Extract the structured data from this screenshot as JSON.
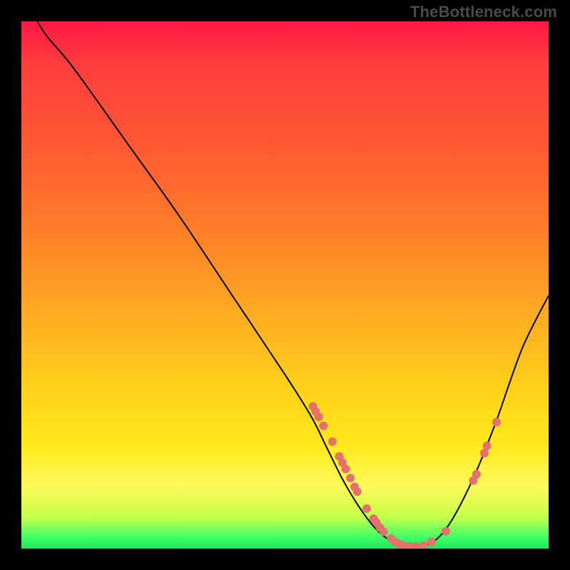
{
  "watermark": "TheBottleneck.com",
  "chart_data": {
    "type": "line",
    "title": "",
    "xlabel": "",
    "ylabel": "",
    "xlim": [
      0,
      100
    ],
    "ylim": [
      0,
      100
    ],
    "grid": false,
    "legend": false,
    "series": [
      {
        "name": "curve",
        "points": [
          {
            "x": 3,
            "y": 100
          },
          {
            "x": 5,
            "y": 97
          },
          {
            "x": 10,
            "y": 91
          },
          {
            "x": 20,
            "y": 77
          },
          {
            "x": 30,
            "y": 63
          },
          {
            "x": 40,
            "y": 48
          },
          {
            "x": 50,
            "y": 33
          },
          {
            "x": 55,
            "y": 25
          },
          {
            "x": 58,
            "y": 19
          },
          {
            "x": 61,
            "y": 13
          },
          {
            "x": 64,
            "y": 8
          },
          {
            "x": 67,
            "y": 4
          },
          {
            "x": 70,
            "y": 1.5
          },
          {
            "x": 73,
            "y": 0.5
          },
          {
            "x": 76,
            "y": 0.5
          },
          {
            "x": 79,
            "y": 2
          },
          {
            "x": 82,
            "y": 6
          },
          {
            "x": 86,
            "y": 14
          },
          {
            "x": 90,
            "y": 24
          },
          {
            "x": 95,
            "y": 38
          },
          {
            "x": 100,
            "y": 48
          }
        ]
      }
    ],
    "markers": [
      {
        "x": 55.3,
        "y": 27
      },
      {
        "x": 55.8,
        "y": 26
      },
      {
        "x": 56.4,
        "y": 25
      },
      {
        "x": 57.3,
        "y": 23.3
      },
      {
        "x": 59.0,
        "y": 20.3
      },
      {
        "x": 60.3,
        "y": 17.5
      },
      {
        "x": 60.9,
        "y": 16.3
      },
      {
        "x": 61.5,
        "y": 15.1
      },
      {
        "x": 62.4,
        "y": 13.4
      },
      {
        "x": 63.2,
        "y": 11.7
      },
      {
        "x": 63.7,
        "y": 10.8
      },
      {
        "x": 65.5,
        "y": 7.6
      },
      {
        "x": 66.8,
        "y": 5.7
      },
      {
        "x": 67.3,
        "y": 5.0
      },
      {
        "x": 68.0,
        "y": 4.0
      },
      {
        "x": 68.7,
        "y": 3.2
      },
      {
        "x": 70.1,
        "y": 1.9
      },
      {
        "x": 71.0,
        "y": 1.2
      },
      {
        "x": 71.6,
        "y": 0.9
      },
      {
        "x": 72.4,
        "y": 0.6
      },
      {
        "x": 73.6,
        "y": 0.4
      },
      {
        "x": 74.8,
        "y": 0.4
      },
      {
        "x": 76.3,
        "y": 0.6
      },
      {
        "x": 77.8,
        "y": 1.3
      },
      {
        "x": 80.5,
        "y": 3.3
      },
      {
        "x": 85.7,
        "y": 12.9
      },
      {
        "x": 86.3,
        "y": 14.1
      },
      {
        "x": 87.8,
        "y": 18.1
      },
      {
        "x": 88.3,
        "y": 19.5
      },
      {
        "x": 90.1,
        "y": 24.0
      }
    ],
    "background_gradient": {
      "direction": "vertical",
      "stops": [
        {
          "pos": 0.0,
          "color": "#ff1744"
        },
        {
          "pos": 0.22,
          "color": "#ff5534"
        },
        {
          "pos": 0.55,
          "color": "#ffaa22"
        },
        {
          "pos": 0.8,
          "color": "#ffe81a"
        },
        {
          "pos": 0.94,
          "color": "#c6ff4a"
        },
        {
          "pos": 1.0,
          "color": "#16e85a"
        }
      ]
    },
    "marker_style": {
      "color": "#e4716b",
      "radius": 6
    },
    "line_style": {
      "color": "#000000",
      "width": 2
    }
  }
}
